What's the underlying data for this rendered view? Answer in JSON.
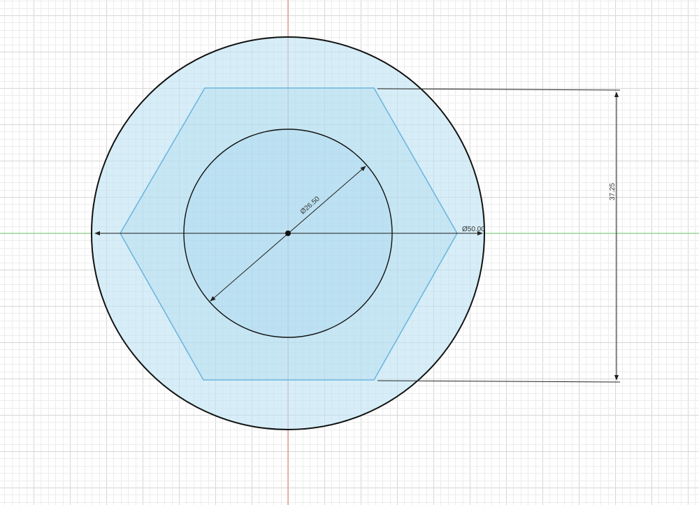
{
  "colors": {
    "background": "#ffffff",
    "grid_minor": "#ececec",
    "grid_major": "#d6d6d6",
    "axis_vertical": "#e6716f",
    "axis_horizontal": "#79d27a",
    "profile_fill": "#bfe3f4",
    "profile_fill_inner": "#a9d8ee",
    "hexagon_stroke": "#6fb6dd",
    "sketch_line": "#111111",
    "dimension_line": "#222222",
    "dimension_text": "#333333"
  },
  "sketch": {
    "outer_circle": {
      "diameter_label": "Ø50.00"
    },
    "inner_circle": {
      "diameter_label": "Ø26.50"
    },
    "hexagon": {
      "height_label": "37.25"
    }
  }
}
